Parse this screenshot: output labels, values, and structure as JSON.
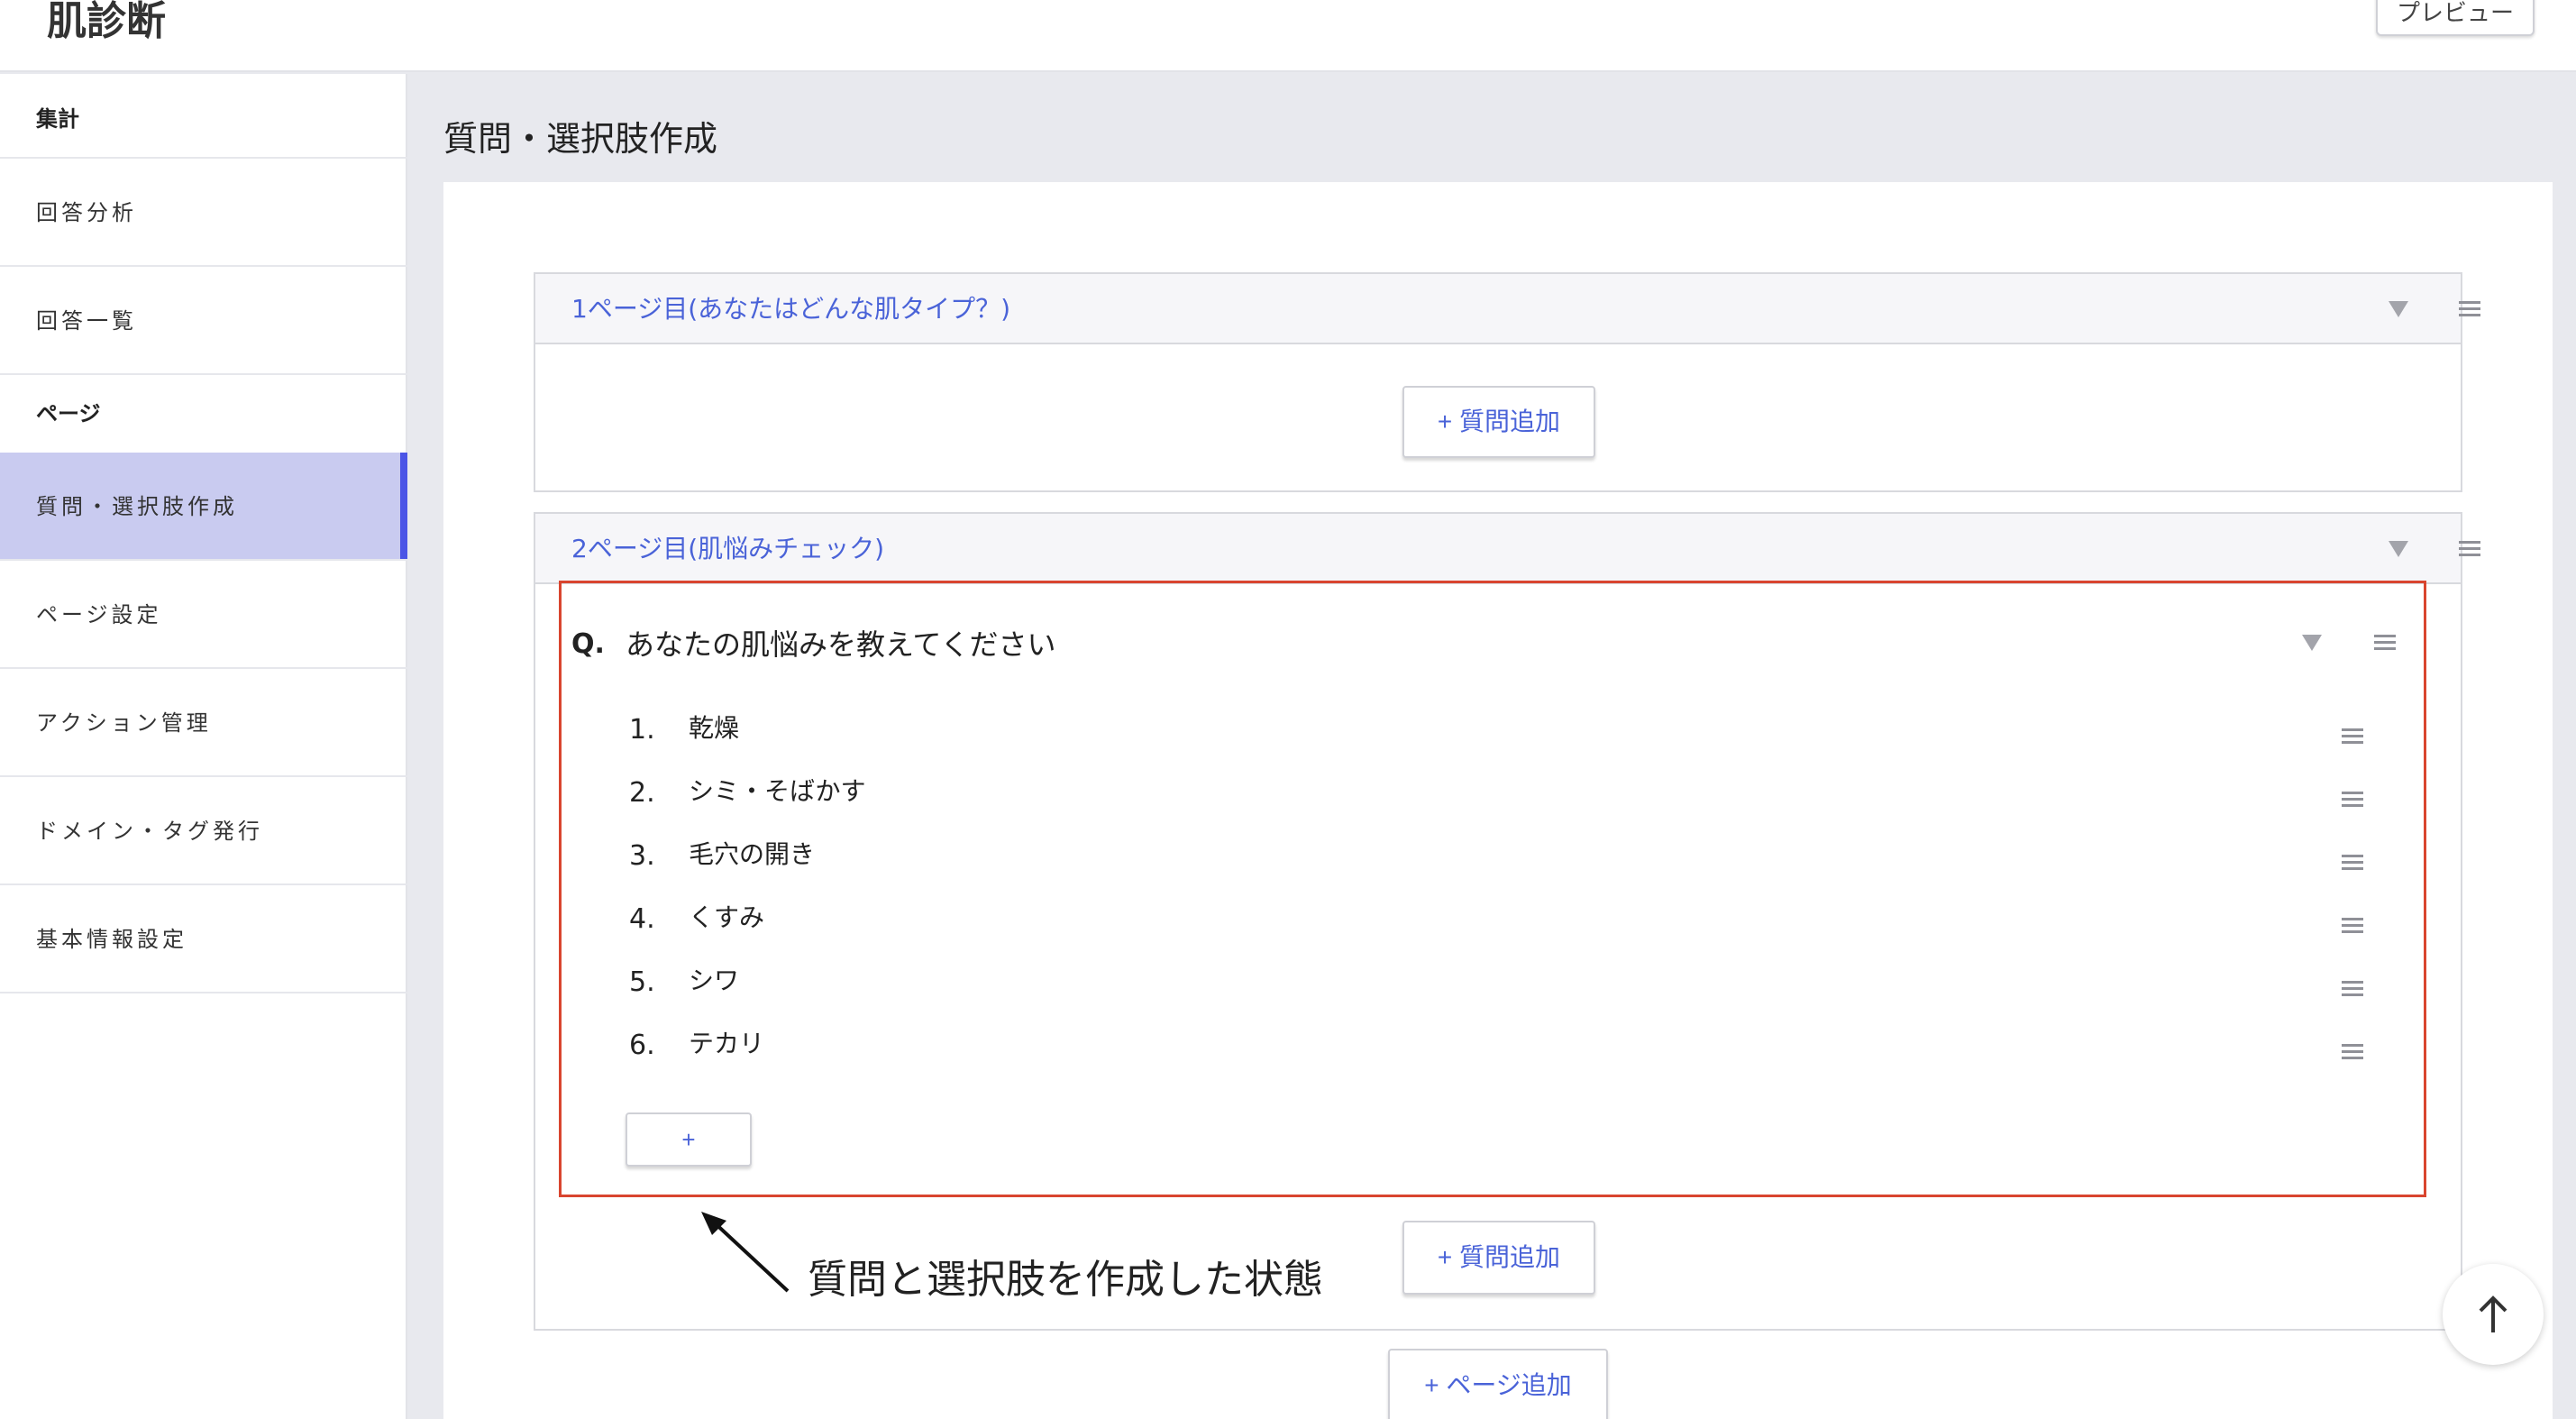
{
  "header": {
    "app_title": "肌診断",
    "preview_label": "プレビュー"
  },
  "sidebar": {
    "section_aggregate": "集計",
    "item_answer_analysis": "回答分析",
    "item_answer_list": "回答一覧",
    "section_page": "ページ",
    "item_question_create": "質問・選択肢作成",
    "item_page_settings": "ページ設定",
    "item_action_management": "アクション管理",
    "item_domain_tag": "ドメイン・タグ発行",
    "item_basic_info": "基本情報設定"
  },
  "main": {
    "heading": "質問・選択肢作成",
    "page1": {
      "title": "1ページ目(あなたはどんな肌タイプ？)",
      "add_question_label": "+ 質問追加"
    },
    "page2": {
      "title": "2ページ目(肌悩みチェック)",
      "question": {
        "label": "Q.",
        "text": "あなたの肌悩みを教えてください",
        "options": [
          {
            "num": "1.",
            "text": "乾燥"
          },
          {
            "num": "2.",
            "text": "シミ・そばかす"
          },
          {
            "num": "3.",
            "text": "毛穴の開き"
          },
          {
            "num": "4.",
            "text": "くすみ"
          },
          {
            "num": "5.",
            "text": "シワ"
          },
          {
            "num": "6.",
            "text": "テカリ"
          }
        ],
        "add_option_label": "+"
      },
      "add_question_label": "+ 質問追加"
    },
    "add_page_label": "+ ページ追加"
  },
  "annotation": {
    "text": "質問と選択肢を作成した状態"
  },
  "icons": {
    "collapse": "triangle-down-icon",
    "drag": "drag-handle-icon",
    "scroll_top": "arrow-up-icon"
  },
  "colors": {
    "accent": "#4a63d8",
    "active_sidebar_bg": "#c9cbf0",
    "active_sidebar_bar": "#4b55e6",
    "highlight_border": "#d9452f"
  }
}
